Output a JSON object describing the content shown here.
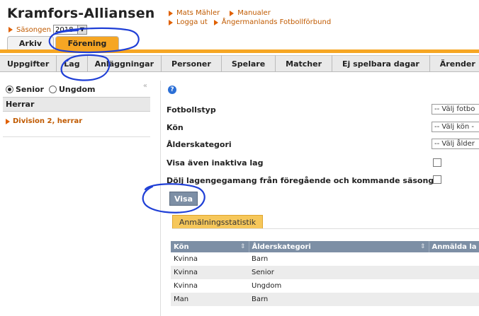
{
  "app": {
    "title": "Kramfors-Alliansen"
  },
  "season": {
    "label": "Säsongen",
    "value": "2018"
  },
  "top_links": {
    "row1": [
      "Mats Mähler",
      "Manualer"
    ],
    "row2": [
      "Logga ut",
      "Ångermanlands Fotbollförbund"
    ]
  },
  "main_tabs": [
    {
      "label": "Arkiv"
    },
    {
      "label": "Förening"
    }
  ],
  "subnav": [
    "Uppgifter",
    "Lag",
    "Anläggningar",
    "Personer",
    "Spelare",
    "Matcher",
    "Ej spelbara dagar",
    "Ärender"
  ],
  "sidebar": {
    "radio_options": [
      {
        "label": "Senior",
        "checked": true
      },
      {
        "label": "Ungdom",
        "checked": false
      }
    ],
    "heading": "Herrar",
    "items": [
      "Division 2, herrar"
    ]
  },
  "form": {
    "fotbollstyp": {
      "label": "Fotbollstyp",
      "value": "-- Välj fotbo"
    },
    "kon": {
      "label": "Kön",
      "value": "-- Välj kön -"
    },
    "alderskategori": {
      "label": "Ålderskategori",
      "value": "-- Välj ålder"
    },
    "visa_inaktiva": {
      "label": "Visa även inaktiva lag"
    },
    "dolj_lagengagemang": {
      "label": "Dölj lagengegamang från föregående och kommande säsong"
    },
    "visa_button": "Visa"
  },
  "stats": {
    "tab_label": "Anmälningsstatistik",
    "columns": [
      "Kön",
      "Ålderskategori",
      "Anmälda la"
    ],
    "rows": [
      {
        "kon": "Kvinna",
        "alder": "Barn"
      },
      {
        "kon": "Kvinna",
        "alder": "Senior"
      },
      {
        "kon": "Kvinna",
        "alder": "Ungdom"
      },
      {
        "kon": "Man",
        "alder": "Barn"
      }
    ]
  },
  "colors": {
    "accent": "#f6a623",
    "link": "#c05a00",
    "table_header": "#7d8fa5",
    "annotation": "#1f3fd6"
  },
  "icons": {
    "help": "help-icon",
    "bullet": "triangle-right-icon"
  }
}
